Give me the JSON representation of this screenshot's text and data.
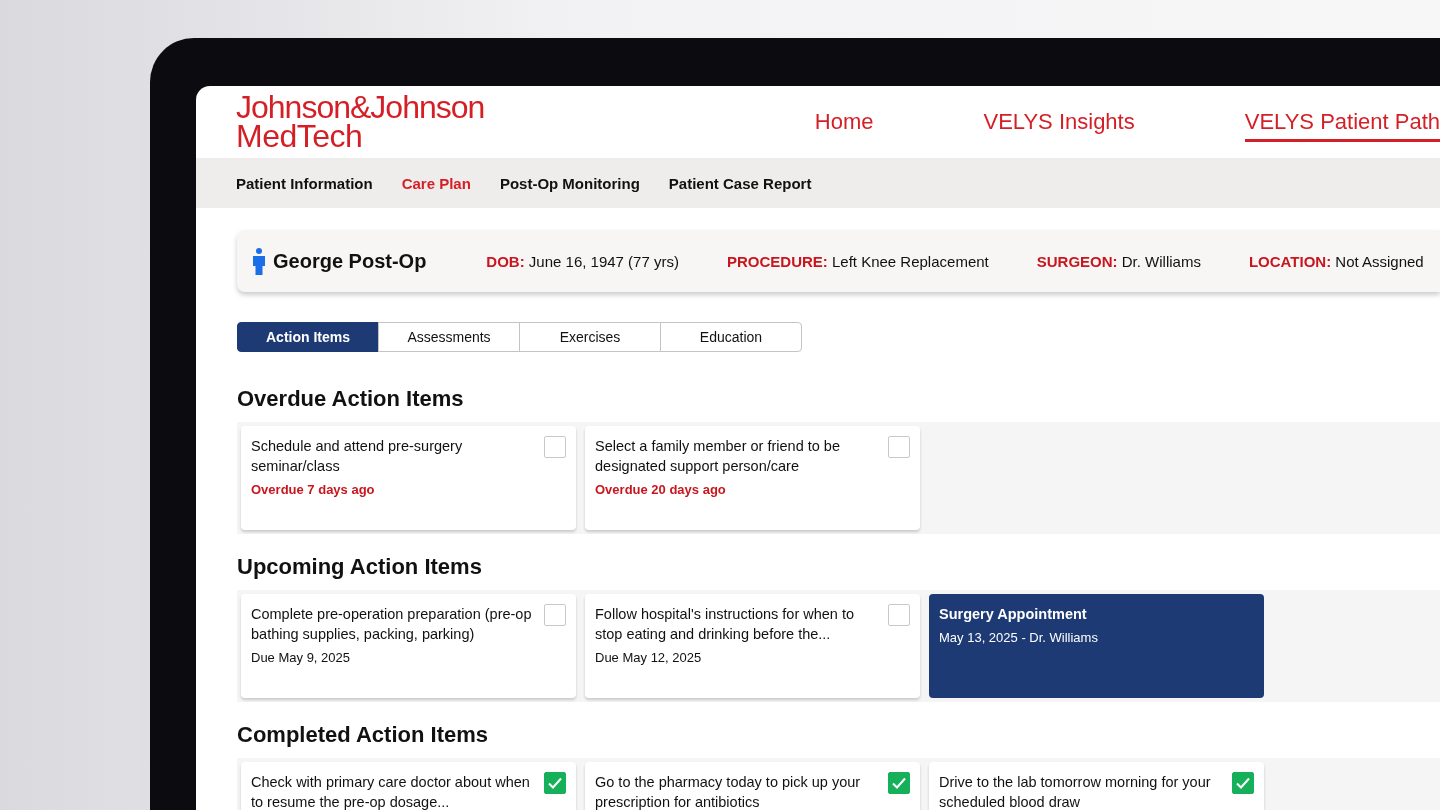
{
  "logo": {
    "wordmark": "Johnson&Johnson",
    "subtitle": "MedTech"
  },
  "nav": [
    {
      "label": "Home",
      "selected": false
    },
    {
      "label": "VELYS Insights",
      "selected": false
    },
    {
      "label": "VELYS Patient Path",
      "selected": true
    }
  ],
  "subnav": [
    {
      "label": "Patient Information",
      "selected": false
    },
    {
      "label": "Care Plan",
      "selected": true
    },
    {
      "label": "Post-Op Monitoring",
      "selected": false
    },
    {
      "label": "Patient Case Report",
      "selected": false
    }
  ],
  "patient": {
    "name": "George Post-Op",
    "fields": [
      {
        "label": "DOB:",
        "value": "June 16, 1947 (77 yrs)"
      },
      {
        "label": "PROCEDURE:",
        "value": "Left Knee Replacement"
      },
      {
        "label": "SURGEON:",
        "value": "Dr. Williams"
      },
      {
        "label": "LOCATION:",
        "value": "Not Assigned"
      }
    ]
  },
  "tabs": [
    {
      "label": "Action Items",
      "selected": true
    },
    {
      "label": "Assessments",
      "selected": false
    },
    {
      "label": "Exercises",
      "selected": false
    },
    {
      "label": "Education",
      "selected": false
    }
  ],
  "sections": [
    {
      "title": "Overdue Action Items",
      "items": [
        {
          "kind": "task",
          "text": "Schedule and attend pre-surgery seminar/class",
          "note": "Overdue 7 days ago",
          "overdue": true,
          "checked": false
        },
        {
          "kind": "task",
          "text": "Select a family member or friend to be designated support person/care",
          "note": "Overdue 20 days ago",
          "overdue": true,
          "checked": false
        }
      ]
    },
    {
      "title": "Upcoming Action Items",
      "items": [
        {
          "kind": "task",
          "text": "Complete pre-operation preparation (pre-op bathing supplies, packing, parking)",
          "note": "Due May 9, 2025",
          "overdue": false,
          "checked": false
        },
        {
          "kind": "task",
          "text": "Follow hospital's instructions for when to stop eating and drinking before the...",
          "note": "Due May 12, 2025",
          "overdue": false,
          "checked": false
        },
        {
          "kind": "appointment",
          "text": "Surgery Appointment",
          "note": "May 13, 2025 - Dr. Williams"
        }
      ]
    },
    {
      "title": "Completed Action Items",
      "items": [
        {
          "kind": "task",
          "text": "Check with primary care doctor about when to resume the pre-op dosage...",
          "checked": true
        },
        {
          "kind": "task",
          "text": "Go to the pharmacy today to pick up your prescription for antibiotics",
          "checked": true
        },
        {
          "kind": "task",
          "text": "Drive to the lab tomorrow morning for your scheduled blood draw",
          "checked": true
        }
      ]
    }
  ]
}
